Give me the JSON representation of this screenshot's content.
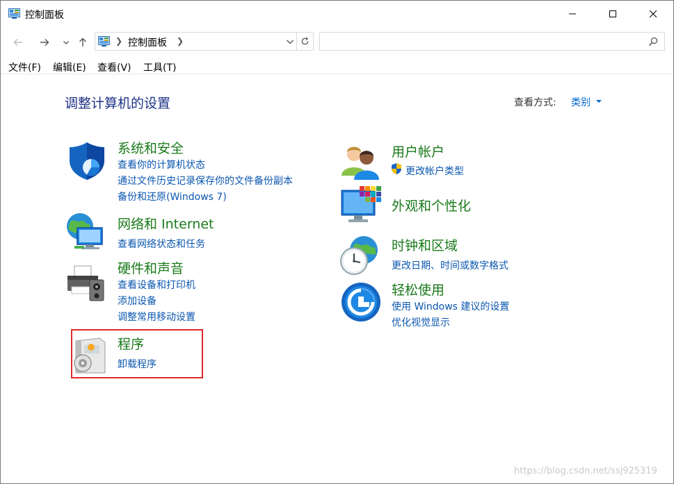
{
  "window": {
    "title": "控制面板"
  },
  "address": {
    "crumb": "控制面板"
  },
  "search": {
    "placeholder": ""
  },
  "menu": [
    "文件(F)",
    "编辑(E)",
    "查看(V)",
    "工具(T)"
  ],
  "page": {
    "heading": "调整计算机的设置",
    "viewby_label": "查看方式:",
    "viewby_value": "类别"
  },
  "categories": {
    "security": {
      "title": "系统和安全",
      "links": [
        "查看你的计算机状态",
        "通过文件历史记录保存你的文件备份副本",
        "备份和还原(Windows 7)"
      ]
    },
    "network": {
      "title": "网络和 Internet",
      "links": [
        "查看网络状态和任务"
      ]
    },
    "hardware": {
      "title": "硬件和声音",
      "links": [
        "查看设备和打印机",
        "添加设备",
        "调整常用移动设置"
      ]
    },
    "programs": {
      "title": "程序",
      "links": [
        "卸载程序"
      ]
    },
    "users": {
      "title": "用户帐户",
      "links": [
        "更改帐户类型"
      ]
    },
    "appearance": {
      "title": "外观和个性化",
      "links": []
    },
    "clock": {
      "title": "时钟和区域",
      "links": [
        "更改日期、时间或数字格式"
      ]
    },
    "ease": {
      "title": "轻松使用",
      "links": [
        "使用 Windows 建议的设置",
        "优化视觉显示"
      ]
    }
  },
  "watermark": "https://blog.csdn.net/ssj925319",
  "colors": {
    "heading": "#1e3287",
    "category_title": "#1a7a1a",
    "link": "#0b57b0",
    "highlight": "#e02a2a"
  }
}
